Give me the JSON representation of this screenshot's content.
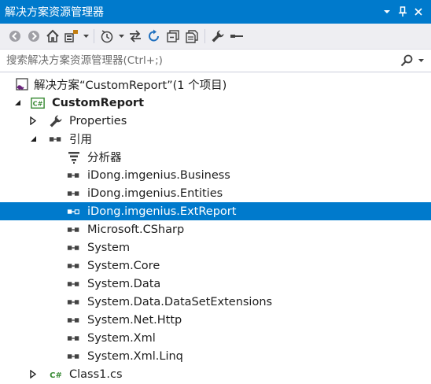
{
  "window": {
    "title": "解决方案资源管理器",
    "pin_glyph": "▾",
    "pin2_glyph": "⊥",
    "close_glyph": "✕"
  },
  "search": {
    "placeholder": "搜索解决方案资源管理器(Ctrl+;)"
  },
  "toolbar": {
    "icons": [
      "back-icon",
      "forward-icon",
      "home-icon",
      "switch-views-icon",
      "pending-changes-filter-icon",
      "sync-icon",
      "refresh-icon",
      "collapse-all-icon",
      "show-all-files-icon",
      "properties-icon",
      "preview-icon"
    ]
  },
  "tree": {
    "solution_label": "解决方案“CustomReport”(1 个项目)",
    "project_label": "CustomReport",
    "properties_label": "Properties",
    "references_label": "引用",
    "analyzers_label": "分析器",
    "references": [
      "iDong.imgenius.Business",
      "iDong.imgenius.Entities",
      "iDong.imgenius.ExtReport",
      "Microsoft.CSharp",
      "System",
      "System.Core",
      "System.Data",
      "System.Data.DataSetExtensions",
      "System.Net.Http",
      "System.Xml",
      "System.Xml.Linq"
    ],
    "selected_reference": "iDong.imgenius.ExtReport",
    "class_file_label": "Class1.cs"
  },
  "colors": {
    "accent": "#007acc",
    "toolbar_bg": "#eeeef2",
    "reference_icon": "#1e1e1e"
  }
}
